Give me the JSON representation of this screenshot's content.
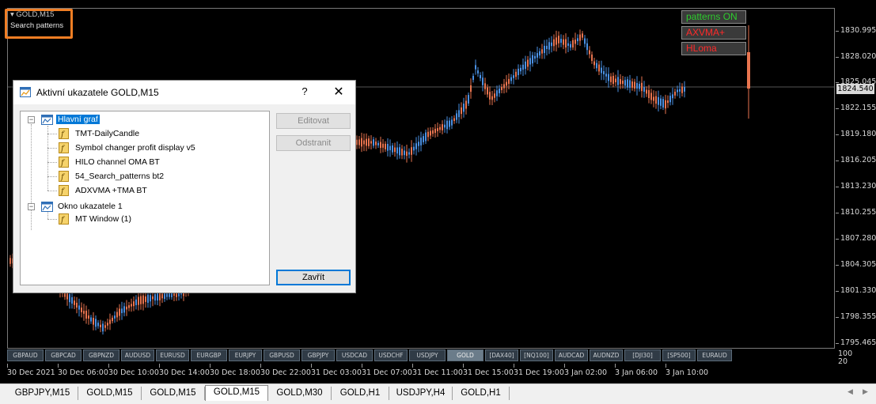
{
  "chart_header": {
    "symbol": "GOLD,M15",
    "indicator_short": "Search patterns"
  },
  "chart_buttons": [
    {
      "label": "patterns ON",
      "color": "#2ecc2e"
    },
    {
      "label": "AXVMA+",
      "color": "#ff2a2a"
    },
    {
      "label": "HLoma",
      "color": "#ff2a2a"
    }
  ],
  "price_axis": {
    "labels": [
      "1830.995",
      "1828.020",
      "1825.045",
      "1822.155",
      "1819.180",
      "1816.205",
      "1813.230",
      "1810.255",
      "1807.280",
      "1804.305",
      "1801.330",
      "1798.355",
      "1795.465"
    ],
    "current_price": "1824.540",
    "subwindow_labels": [
      "100",
      "20"
    ]
  },
  "time_axis": {
    "labels": [
      "30 Dec 2021",
      "30 Dec 06:00",
      "30 Dec 10:00",
      "30 Dec 14:00",
      "30 Dec 18:00",
      "30 Dec 22:00",
      "31 Dec 03:00",
      "31 Dec 07:00",
      "31 Dec 11:00",
      "31 Dec 15:00",
      "31 Dec 19:00",
      "3 Jan 02:00",
      "3 Jan 06:00",
      "3 Jan 10:00"
    ]
  },
  "symbol_buttons": {
    "items": [
      "GBPAUD",
      "GBPCAD",
      "GBPNZD",
      "AUDUSD",
      "EURUSD",
      "EURGBP",
      "EURJPY",
      "GBPUSD",
      "GBPJPY",
      "USDCAD",
      "USDCHF",
      "USDJPY",
      "GOLD",
      "[DAX40]",
      "[NQ100]",
      "AUDCAD",
      "AUDNZD",
      "[DJI30]",
      "[SP500]",
      "EURAUD"
    ],
    "active": "GOLD"
  },
  "colors": {
    "bull": "#4a90e2",
    "bear": "#e8744f",
    "accent_orange": "#f07e24",
    "selection": "#0078d7"
  },
  "dialog": {
    "title": "Aktivní ukazatele GOLD,M15",
    "help": "?",
    "close": "✕",
    "tree": [
      {
        "label": "Hlavní graf",
        "type": "window",
        "children": [
          "TMT-DailyCandle",
          "Symbol changer profit display v5",
          "HILO channel OMA BT",
          "54_Search_patterns bt2",
          "ADXVMA +TMA  BT"
        ]
      },
      {
        "label": "Okno ukazatele 1",
        "type": "window",
        "children": [
          "MT Window (1)"
        ]
      }
    ],
    "buttons": {
      "edit": "Editovat",
      "remove": "Odstranit",
      "close": "Zavřít"
    }
  },
  "tabs": {
    "items": [
      "GBPJPY,M15",
      "GOLD,M15",
      "GOLD,M15",
      "GOLD,M15",
      "GOLD,M30",
      "GOLD,H1",
      "USDJPY,H4",
      "GOLD,H1"
    ],
    "active_index": 3
  }
}
